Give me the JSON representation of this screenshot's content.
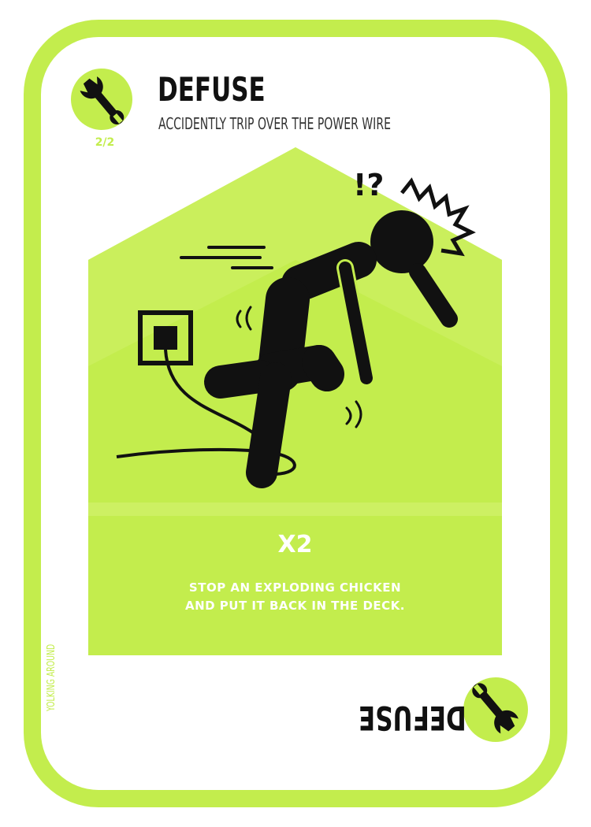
{
  "card": {
    "title": "DEFUSE",
    "subtitle": "ACCIDENTLY TRIP OVER THE POWER WIRE",
    "count": "2/2",
    "multiplier": "X2",
    "rule_lines": [
      "STOP AN EXPLODING CHICKEN",
      "AND PUT IT BACK IN THE DECK."
    ],
    "bottom_title": "DEFUSE",
    "credit": "YOLKING AROUND",
    "exclaim": "!?",
    "icon": "wrench-icon"
  },
  "colors": {
    "accent": "#c3ed4d",
    "ink": "#111111",
    "panel_light": "#cdf063",
    "panel_dark": "#b6e23d"
  }
}
